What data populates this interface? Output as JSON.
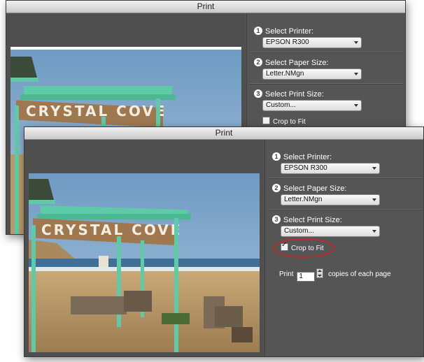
{
  "back_window": {
    "title": "Print",
    "steps": [
      {
        "num": "1",
        "label": "Select Printer:",
        "value": "EPSON R300"
      },
      {
        "num": "2",
        "label": "Select Paper Size:",
        "value": "Letter.NMgn"
      },
      {
        "num": "3",
        "label": "Select Print Size:",
        "value": "Custom..."
      }
    ],
    "crop_label": "Crop to Fit",
    "crop_checked": false,
    "photo_sign_text": "CRYSTAL COVE"
  },
  "front_window": {
    "title": "Print",
    "steps": [
      {
        "num": "1",
        "label": "Select Printer:",
        "value": "EPSON R300"
      },
      {
        "num": "2",
        "label": "Select Paper Size:",
        "value": "Letter.NMgn"
      },
      {
        "num": "3",
        "label": "Select Print Size:",
        "value": "Custom..."
      }
    ],
    "crop_label": "Crop to Fit",
    "crop_checked": true,
    "copies": {
      "prefix": "Print",
      "value": "1",
      "suffix": "copies of each page"
    },
    "photo_sign_text": "CRYSTAL COVE"
  },
  "colors": {
    "highlight_ring": "#c62828",
    "sign_teal": "#5fcaa8",
    "sky": "#7fa8cc"
  }
}
